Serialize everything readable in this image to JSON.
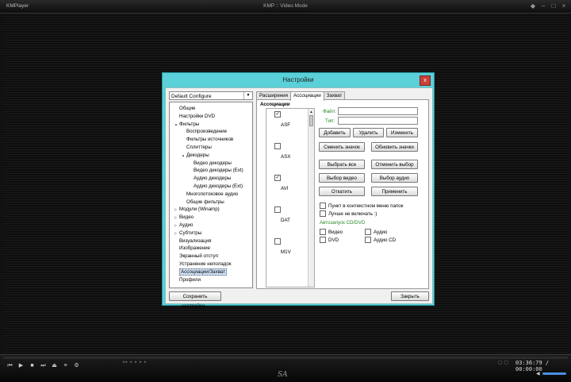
{
  "player": {
    "app_name": "KMPlayer",
    "mode": "KMP :: Video Mode",
    "time_current": "03:36:79",
    "time_total": "00:00:00",
    "signature": "SA"
  },
  "dialog": {
    "title": "Настройки",
    "close": "x",
    "combo_value": "Default Configure",
    "save_button": "Сохранить настройки...",
    "close_button": "Закрыть",
    "tree": [
      {
        "label": "Общие",
        "level": 0,
        "exp": ""
      },
      {
        "label": "Настройки DVD",
        "level": 0,
        "exp": ""
      },
      {
        "label": "Фильтры",
        "level": 0,
        "exp": "▲"
      },
      {
        "label": "Воспроизведение",
        "level": 1,
        "exp": ""
      },
      {
        "label": "Фильтры источников",
        "level": 1,
        "exp": ""
      },
      {
        "label": "Сплиттеры",
        "level": 1,
        "exp": ""
      },
      {
        "label": "Декодеры",
        "level": 1,
        "exp": "▲"
      },
      {
        "label": "Видео декодеры",
        "level": 2,
        "exp": ""
      },
      {
        "label": "Видео декодеры (Ext)",
        "level": 2,
        "exp": ""
      },
      {
        "label": "Аудио декодеры",
        "level": 2,
        "exp": ""
      },
      {
        "label": "Аудио декодеры (Ext)",
        "level": 2,
        "exp": ""
      },
      {
        "label": "Многопотоковое аудио",
        "level": 1,
        "exp": ""
      },
      {
        "label": "Общие фильтры",
        "level": 1,
        "exp": ""
      },
      {
        "label": "Модули (Winamp)",
        "level": 0,
        "exp": "▷"
      },
      {
        "label": "Видео",
        "level": 0,
        "exp": "▷"
      },
      {
        "label": "Аудио",
        "level": 0,
        "exp": "▷"
      },
      {
        "label": "Субтитры",
        "level": 0,
        "exp": "▷"
      },
      {
        "label": "Визуализация",
        "level": 0,
        "exp": ""
      },
      {
        "label": "Изображение",
        "level": 0,
        "exp": ""
      },
      {
        "label": "Экранный отступ",
        "level": 0,
        "exp": ""
      },
      {
        "label": "Устранение неполадок",
        "level": 0,
        "exp": ""
      },
      {
        "label": "Ассоциации/Захват",
        "level": 0,
        "exp": "",
        "selected": true
      },
      {
        "label": "Профили",
        "level": 0,
        "exp": ""
      }
    ],
    "tabs": [
      {
        "label": "Расширения",
        "active": false
      },
      {
        "label": "Ассоциации",
        "active": true
      },
      {
        "label": "Захват",
        "active": false
      }
    ],
    "assoc": {
      "title": "Ассоциации",
      "extensions": [
        {
          "name": "ASF",
          "checked": true
        },
        {
          "name": "ASX",
          "checked": false
        },
        {
          "name": "AVI",
          "checked": true
        },
        {
          "name": "DAT",
          "checked": false
        },
        {
          "name": "M1V",
          "checked": false
        }
      ],
      "file_label": "Файл:",
      "type_label": "Тип:",
      "buttons": {
        "add": "Добавить",
        "delete": "Удалить",
        "change": "Изменить",
        "change_icon": "Сменить значок",
        "refresh_icons": "Обновить значки",
        "select_all": "Выбрать все",
        "deselect": "Отменить выбор",
        "select_video": "Выбор видео",
        "select_audio": "Выбор аудио",
        "rollback": "Откатить",
        "apply": "Применить"
      },
      "ctx_menu": "Пункт в контекстном меню папок",
      "better_not": "Лучше не включать :)",
      "autorun_title": "Автозапуск CD/DVD",
      "autorun": {
        "video": "Видео",
        "audio": "Аудио",
        "dvd": "DVD",
        "audio_cd": "Аудио CD"
      }
    }
  }
}
